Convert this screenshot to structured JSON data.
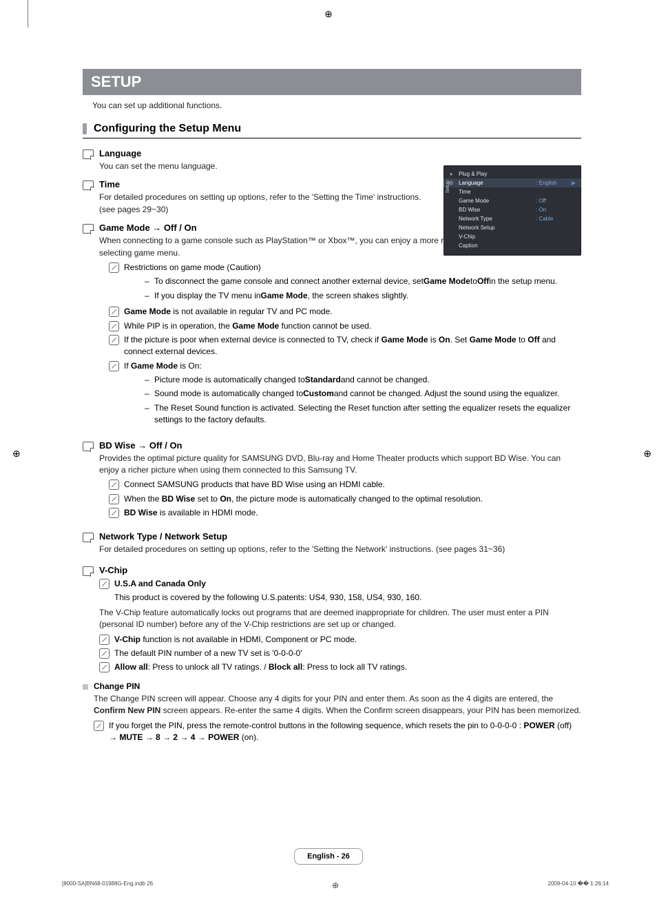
{
  "printers_mark": "⊕",
  "banner": "SETUP",
  "intro": "You can set up additional functions.",
  "section_title": "Configuring the Setup Menu",
  "osd": {
    "side": "Setup",
    "rows": [
      {
        "icon": "●",
        "label": "Plug & Play",
        "val": "",
        "hi": false
      },
      {
        "icon": "✿",
        "label": "Language",
        "val": ": English",
        "hi": true,
        "arrow": "▶"
      },
      {
        "icon": "",
        "label": "Time",
        "val": "",
        "hi": false
      },
      {
        "icon": "",
        "label": "Game Mode",
        "val": ": Off",
        "hi": false
      },
      {
        "icon": "",
        "label": "BD Wise",
        "val": ": On",
        "hi": false
      },
      {
        "icon": "",
        "label": "Network Type",
        "val": ": Cable",
        "hi": false
      },
      {
        "icon": "",
        "label": "Network Setup",
        "val": "",
        "hi": false
      },
      {
        "icon": "",
        "label": "V-Chip",
        "val": "",
        "hi": false
      },
      {
        "icon": "",
        "label": "Caption",
        "val": "",
        "hi": false
      }
    ]
  },
  "language": {
    "title": "Language",
    "body": "You can set the menu language."
  },
  "time": {
    "title": "Time",
    "body1": "For detailed procedures on setting up options, refer to the 'Setting the Time' instructions.",
    "body2": "(see pages 29~30)"
  },
  "game": {
    "title": "Game Mode → Off / On",
    "intro": "When connecting to a game console such as PlayStation™ or Xbox™, you can enjoy a more realistic gaming experience by selecting game menu.",
    "n1": "Restrictions on game mode (Caution)",
    "n1b1a": "To disconnect the game console and connect another external device, set ",
    "n1b1b": "Game Mode",
    "n1b1c": " to ",
    "n1b1d": "Off",
    "n1b1e": " in the setup menu.",
    "n1b2a": "If you display the TV menu in ",
    "n1b2b": "Game Mode",
    "n1b2c": ", the screen shakes slightly.",
    "n2a": "Game Mode",
    "n2b": " is not available in regular TV and PC mode.",
    "n3a": "While PIP is in operation, the ",
    "n3b": "Game Mode",
    "n3c": " function cannot be used.",
    "n4a": "If the picture is poor when external device is connected to TV, check if ",
    "n4b": "Game Mode",
    "n4c": " is ",
    "n4d": "On",
    "n4e": ". Set ",
    "n4f": "Game Mode",
    "n4g": " to ",
    "n4h": "Off",
    "n4i": " and connect external devices.",
    "n5a": "If ",
    "n5b": "Game Mode",
    "n5c": " is On:",
    "n5b1a": "Picture mode is automatically changed to ",
    "n5b1b": "Standard",
    "n5b1c": " and cannot be changed.",
    "n5b2a": "Sound mode is automatically changed to ",
    "n5b2b": "Custom",
    "n5b2c": " and cannot be changed. Adjust the sound using the equalizer.",
    "n5b3": "The Reset Sound function is activated. Selecting the Reset function after setting the equalizer resets the equalizer settings to the factory defaults."
  },
  "bdwise": {
    "title": "BD Wise → Off / On",
    "intro": "Provides the optimal picture quality for SAMSUNG DVD, Blu-ray and Home Theater products which support BD Wise. You can enjoy a richer picture when using them connected to this Samsung TV.",
    "n1": "Connect SAMSUNG products that have BD Wise using an HDMI cable.",
    "n2a": "When the ",
    "n2b": "BD Wise",
    "n2c": " set to ",
    "n2d": "On",
    "n2e": ", the picture mode is automatically changed to the optimal resolution.",
    "n3a": "BD Wise",
    "n3b": " is available in HDMI mode."
  },
  "network": {
    "title": "Network Type / Network Setup",
    "body": "For detailed procedures on setting up options, refer to the 'Setting the Network' instructions. (see pages 31~36)"
  },
  "vchip": {
    "title": "V-Chip",
    "n1": "U.S.A and Canada Only",
    "n1body": "This product is covered by the following U.S.patents: US4, 930, 158, US4, 930, 160.",
    "intro": "The V-Chip feature automatically locks out programs that are deemed inappropriate for children. The user must enter a PIN (personal ID number) before any of the V-Chip restrictions are set up or changed.",
    "n2a": "V-Chip",
    "n2b": " function is not available in HDMI, Component or PC mode.",
    "n3": "The default PIN number of a new TV set is '0-0-0-0'",
    "n4a": "Allow all",
    "n4b": ": Press to unlock all TV ratings. / ",
    "n4c": "Block all",
    "n4d": ": Press to lock all TV ratings."
  },
  "changepin": {
    "title": "Change PIN",
    "body1a": "The Change PIN screen will appear. Choose any 4 digits for your PIN and enter them. As soon as the 4 digits are entered, the ",
    "body1b": "Confirm New PIN",
    "body1c": " screen appears. Re-enter the same 4 digits. When the Confirm screen disappears, your PIN has been memorized.",
    "n1a": "If you forget the PIN, press the remote-control buttons in the following sequence, which resets the pin to 0-0-0-0 : ",
    "n1seq": "POWER (off) → MUTE → 8 → 2 → 4 → POWER (on)."
  },
  "footer": "English - 26",
  "tiny_left": "[8000-SA]BN68-01988G-Eng.indb   26",
  "tiny_right": "2009-04-10   �� 1:26:14"
}
